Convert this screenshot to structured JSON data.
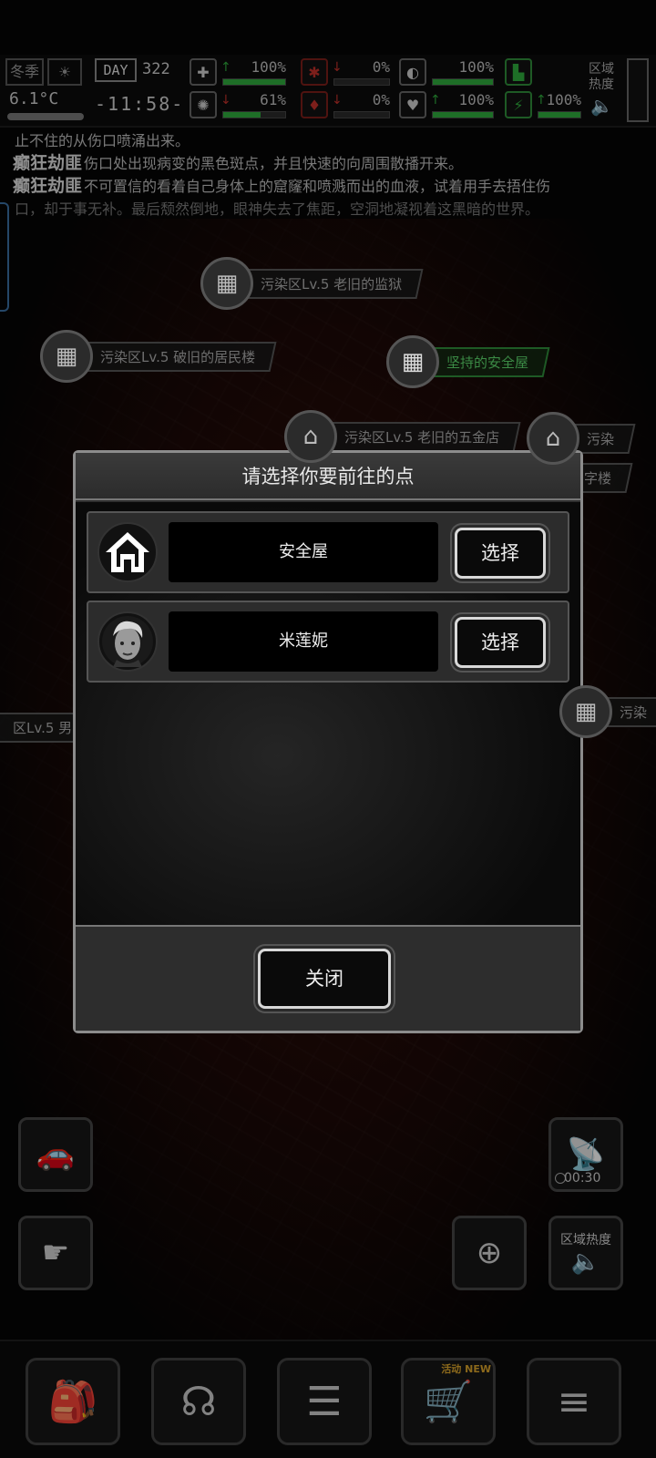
{
  "status": {
    "season": "冬季",
    "temperature": "6.1°C",
    "day_label": "DAY",
    "day_number": "322",
    "time": "-11:58-",
    "stats": [
      {
        "id": "health",
        "icon": "medkit-icon",
        "value": "100%",
        "fill": 1.0,
        "color": "#2faa3c"
      },
      {
        "id": "bleeding",
        "icon": "bleed-icon",
        "value": "0%",
        "fill": 0.0,
        "color": "#c0302a"
      },
      {
        "id": "stamina",
        "icon": "stomach-icon",
        "value": "100%",
        "fill": 1.0,
        "color": "#2faa3c"
      },
      {
        "id": "brain",
        "icon": "brain-icon",
        "value": "61%",
        "fill": 0.61,
        "color": "#2faa3c"
      },
      {
        "id": "blood",
        "icon": "blood-drop-icon",
        "value": "0%",
        "fill": 0.0,
        "color": "#c0302a"
      },
      {
        "id": "heart",
        "icon": "heart-icon",
        "value": "100%",
        "fill": 1.0,
        "color": "#2faa3c"
      },
      {
        "id": "energy",
        "icon": "energy-icon",
        "value": "100%",
        "fill": 1.0,
        "color": "#2faa3c"
      }
    ],
    "region_heat_label": "区域热度"
  },
  "log": {
    "lines": [
      {
        "speaker": "",
        "text": "止不住的从伤口喷涌出来。"
      },
      {
        "speaker": "癫狂劫匪",
        "text": "伤口处出现病变的黑色斑点，并且快速的向周围散播开来。"
      },
      {
        "speaker": "癫狂劫匪",
        "text": "不可置信的看着自己身体上的窟窿和喷溅而出的血液，试着用手去捂住伤"
      },
      {
        "speaker": "",
        "text": "口，却于事无补。最后颓然倒地，眼神失去了焦距，空洞地凝视着这黑暗的世界。"
      }
    ]
  },
  "map": {
    "markers": [
      {
        "label": "污染区Lv.5 老旧的监狱",
        "type": "building"
      },
      {
        "label": "污染区Lv.5 破旧的居民楼",
        "type": "building"
      },
      {
        "label": "坚持的安全屋",
        "type": "safe"
      },
      {
        "label": "污染区Lv.5 老旧的五金店",
        "type": "shop"
      },
      {
        "label": "污染",
        "type": "shop"
      },
      {
        "label": "写字楼",
        "type": "building"
      },
      {
        "label": "区Lv.5 男",
        "type": "building"
      },
      {
        "label": "污染",
        "type": "building"
      }
    ]
  },
  "dialog": {
    "title": "请选择你要前往的点",
    "options": [
      {
        "name": "安全屋",
        "icon": "house-icon",
        "select_label": "选择"
      },
      {
        "name": "米莲妮",
        "icon": "portrait-avatar",
        "select_label": "选择"
      }
    ],
    "close_label": "关闭"
  },
  "side_buttons": {
    "car": "car-icon",
    "satellite_timer": "00:30",
    "tap_action": "tap-hand-icon",
    "map_note": "map-card-icon",
    "region_heat": "区域热度"
  },
  "bottom_nav": {
    "items": [
      "backpack-icon",
      "brain-head-icon",
      "notebook-icon",
      "shopping-cart-icon",
      "menu-list-icon"
    ],
    "cart_badge": "活动 NEW"
  }
}
